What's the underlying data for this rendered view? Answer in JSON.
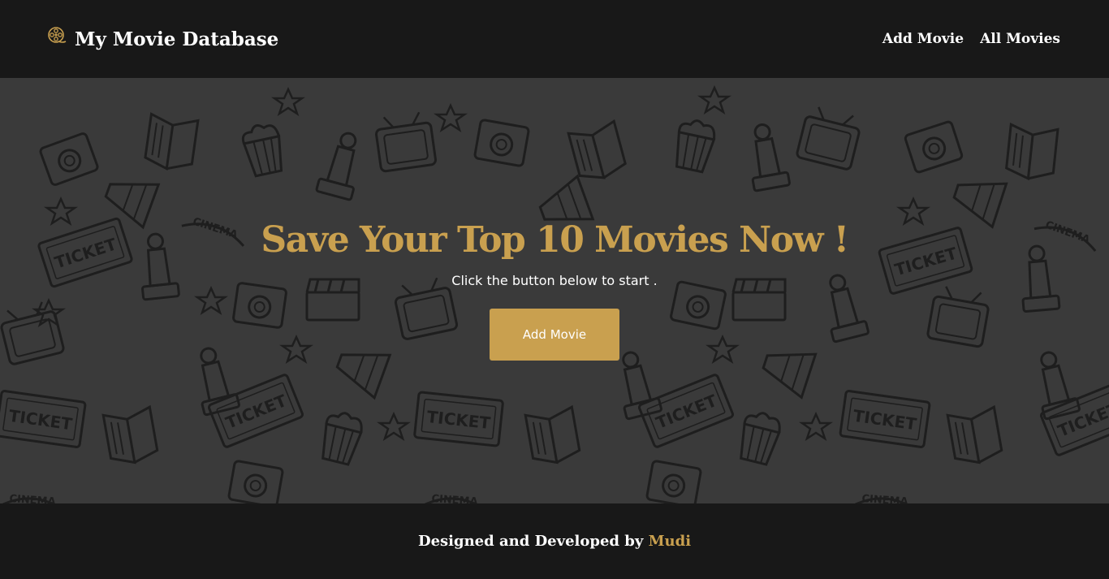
{
  "nav": {
    "brand": "My Movie Database",
    "brand_icon": "film-reel-icon",
    "links": [
      "Add Movie",
      "All Movies"
    ]
  },
  "hero": {
    "title": "Save Your Top 10 Movies Now !",
    "subtitle": "Click the button below to start .",
    "button": "Add Movie",
    "pattern_words": [
      "TICKET",
      "CINEMA"
    ]
  },
  "footer": {
    "prefix": "Designed and Developed by ",
    "author": "Mudi"
  },
  "colors": {
    "accent": "#c9a04f",
    "bar": "#181818",
    "hero_bg": "#3a3a3a",
    "pattern_stroke": "#1e1e1e"
  }
}
